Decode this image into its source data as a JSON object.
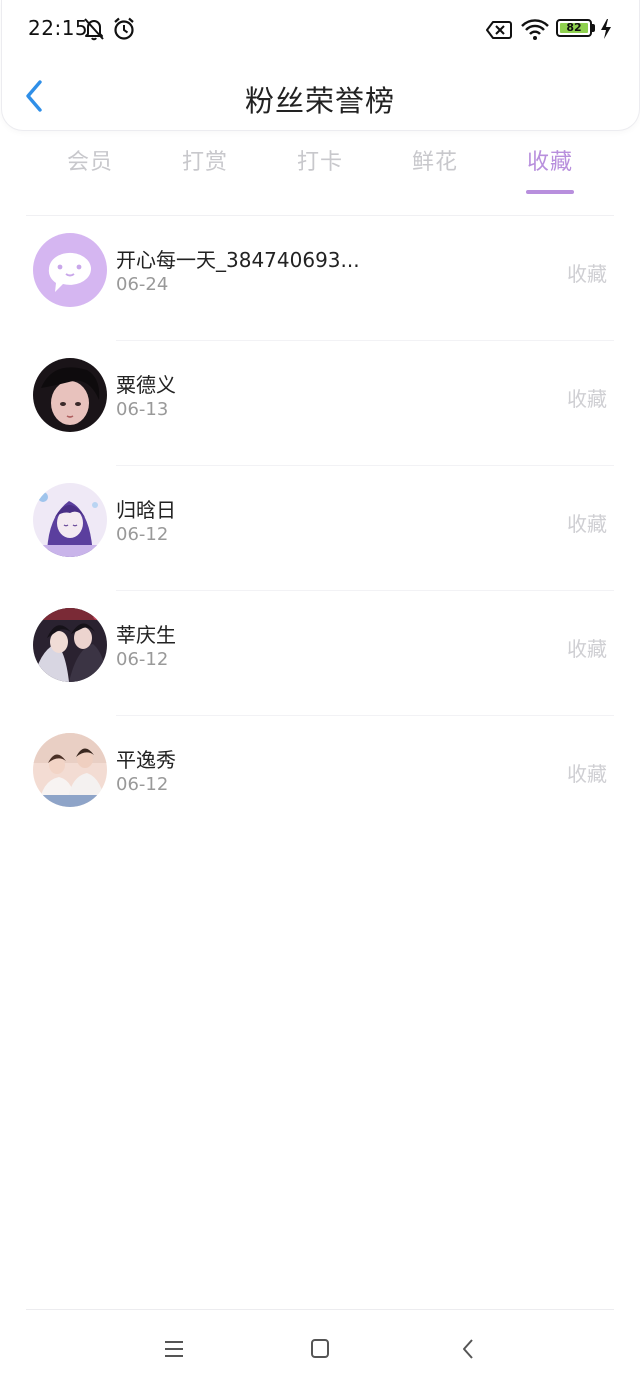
{
  "status_bar": {
    "time": "22:15",
    "battery_level": "82",
    "icons": [
      "mute-bell-icon",
      "alarm-icon",
      "sim-blocked-icon",
      "wifi-icon",
      "battery-icon",
      "charging-icon"
    ]
  },
  "header": {
    "title": "粉丝荣誉榜",
    "back_icon": "chevron-left-icon"
  },
  "tabs": [
    {
      "label": "会员",
      "active": false
    },
    {
      "label": "打赏",
      "active": false
    },
    {
      "label": "打卡",
      "active": false
    },
    {
      "label": "鲜花",
      "active": false
    },
    {
      "label": "收藏",
      "active": true
    }
  ],
  "colors": {
    "accent": "#b88fdd",
    "back_icon": "#2f8fe8",
    "inactive_tab": "#c8c8cc",
    "date_text": "#999999",
    "action_text": "#cfcfd3"
  },
  "fans": [
    {
      "name": "开心每一天_384740693...",
      "date": "06-24",
      "action": "收藏"
    },
    {
      "name": "粟德义",
      "date": "06-13",
      "action": "收藏"
    },
    {
      "name": "归晗日",
      "date": "06-12",
      "action": "收藏"
    },
    {
      "name": "莘庆生",
      "date": "06-12",
      "action": "收藏"
    },
    {
      "name": "平逸秀",
      "date": "06-12",
      "action": "收藏"
    }
  ],
  "nav_bar": {
    "buttons": [
      "menu-icon",
      "home-icon",
      "back-icon"
    ]
  }
}
